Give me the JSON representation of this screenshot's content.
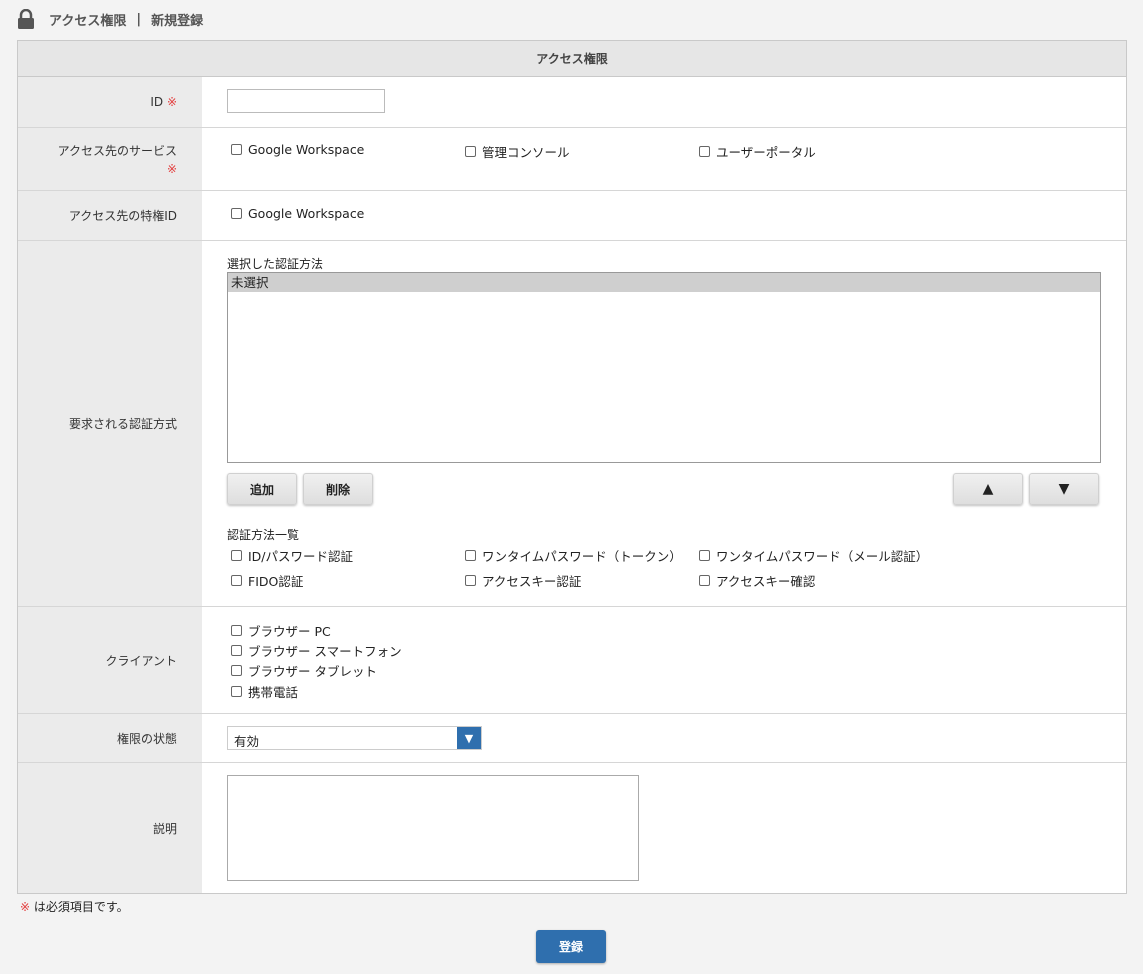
{
  "header": {
    "section": "アクセス権限",
    "separator": "|",
    "page": "新規登録",
    "icon": "lock-icon"
  },
  "panel": {
    "title": "アクセス権限"
  },
  "required_mark": "※",
  "fields": {
    "id": {
      "label": "ID",
      "value": ""
    },
    "service": {
      "label": "アクセス先のサービス",
      "options": [
        "Google Workspace",
        "管理コンソール",
        "ユーザーポータル"
      ]
    },
    "privilege": {
      "label": "アクセス先の特権ID",
      "options": [
        "Google Workspace"
      ]
    },
    "auth": {
      "label": "要求される認証方式",
      "selected_label": "選択した認証方法",
      "selected_items": [
        "未選択"
      ],
      "add_button": "追加",
      "delete_button": "削除",
      "up_button": "▲",
      "down_button": "▼",
      "methods_label": "認証方法一覧",
      "methods": [
        "ID/パスワード認証",
        "ワンタイムパスワード（トークン）",
        "ワンタイムパスワード（メール認証）",
        "FIDO認証",
        "アクセスキー認証",
        "アクセスキー確認"
      ]
    },
    "client": {
      "label": "クライアント",
      "options": [
        "ブラウザー PC",
        "ブラウザー スマートフォン",
        "ブラウザー タブレット",
        "携帯電話"
      ]
    },
    "state": {
      "label": "権限の状態",
      "value": "有効"
    },
    "description": {
      "label": "説明",
      "value": ""
    }
  },
  "footer": {
    "note_mark": "※",
    "note": " は必須項目です。",
    "submit": "登録"
  },
  "colors": {
    "accent": "#2f6fae",
    "required": "#e34040",
    "label_bg": "#ebebeb"
  }
}
